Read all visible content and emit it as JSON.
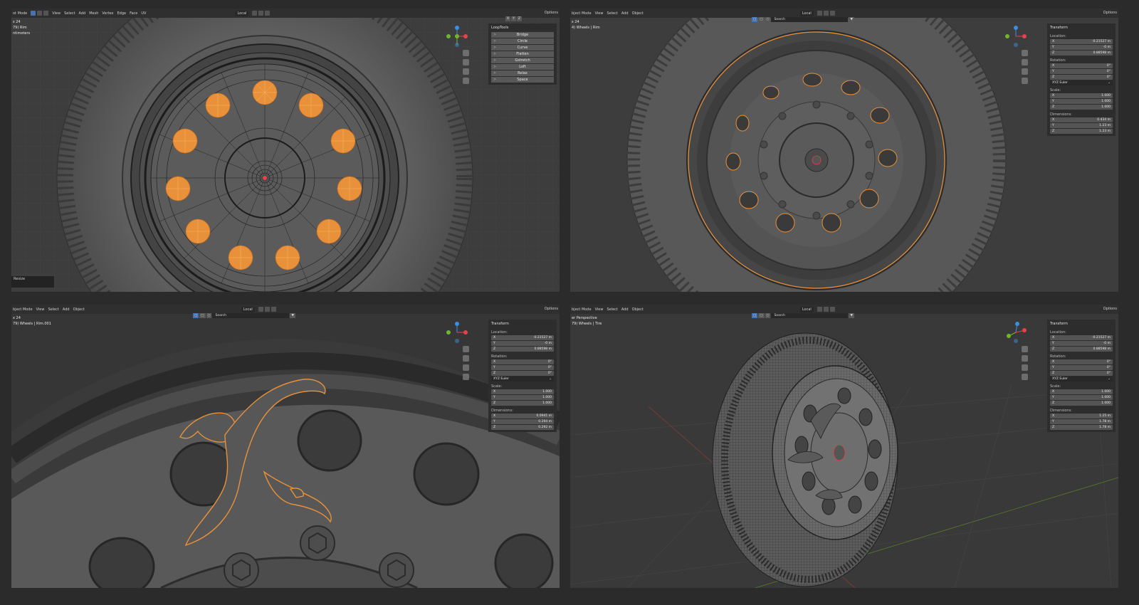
{
  "viewports": {
    "tl": {
      "header": {
        "menus": [
          "ot Mode",
          "View",
          "Select",
          "Add",
          "Mesh",
          "Vertex",
          "Edge",
          "Face",
          "UV"
        ],
        "transform_orientation": "Local",
        "options": "Options"
      },
      "overlay": [
        "s 24",
        "79) Rim",
        "ntimeters"
      ],
      "panel": {
        "title": "LoopTools",
        "tools": [
          "Bridge",
          "Circle",
          "Curve",
          "Flatten",
          "Gstretch",
          "Loft",
          "Relax",
          "Space"
        ]
      },
      "axes_buttons": [
        "X",
        "Y",
        "Z"
      ],
      "status": "Resize"
    },
    "tr": {
      "header": {
        "menus": [
          "bject Mode",
          "View",
          "Select",
          "Add",
          "Object"
        ],
        "transform_orientation": "Local",
        "search_placeholder": "Search",
        "options": "Options"
      },
      "overlay": [
        "s 24",
        "4) Wheels | Rim"
      ],
      "panel": {
        "title": "Transform",
        "location_label": "Location:",
        "location": [
          {
            "axis": "X",
            "value": "-0.21527 m"
          },
          {
            "axis": "Y",
            "value": "-0 m"
          },
          {
            "axis": "Z",
            "value": "0.88598 m"
          }
        ],
        "rotation_label": "Rotation:",
        "rotation": [
          {
            "axis": "X",
            "value": "0°"
          },
          {
            "axis": "Y",
            "value": "0°"
          },
          {
            "axis": "Z",
            "value": "0°"
          }
        ],
        "rotation_mode": "XYZ Euler",
        "scale_label": "Scale:",
        "scale": [
          {
            "axis": "X",
            "value": "1.000"
          },
          {
            "axis": "Y",
            "value": "1.000"
          },
          {
            "axis": "Z",
            "value": "1.000"
          }
        ],
        "dimensions_label": "Dimensions:",
        "dimensions": [
          {
            "axis": "X",
            "value": "0.434 m"
          },
          {
            "axis": "Y",
            "value": "1.23 m"
          },
          {
            "axis": "Z",
            "value": "1.23 m"
          }
        ]
      }
    },
    "bl": {
      "header": {
        "menus": [
          "bject Mode",
          "View",
          "Select",
          "Add",
          "Object"
        ],
        "transform_orientation": "Local",
        "search_placeholder": "Search",
        "options": "Options"
      },
      "overlay": [
        "x 24",
        "79) Wheels | Rim.001"
      ],
      "panel": {
        "title": "Transform",
        "location_label": "Location:",
        "location": [
          {
            "axis": "X",
            "value": "-0.21527 m"
          },
          {
            "axis": "Y",
            "value": "-0 m"
          },
          {
            "axis": "Z",
            "value": "0.88598 m"
          }
        ],
        "rotation_label": "Rotation:",
        "rotation": [
          {
            "axis": "X",
            "value": "0°"
          },
          {
            "axis": "Y",
            "value": "0°"
          },
          {
            "axis": "Z",
            "value": "0°"
          }
        ],
        "rotation_mode": "XYZ Euler",
        "scale_label": "Scale:",
        "scale": [
          {
            "axis": "X",
            "value": "1.000"
          },
          {
            "axis": "Y",
            "value": "1.000"
          },
          {
            "axis": "Z",
            "value": "1.000"
          }
        ],
        "dimensions_label": "Dimensions:",
        "dimensions": [
          {
            "axis": "X",
            "value": "0.0941 m"
          },
          {
            "axis": "Y",
            "value": "0.294 m"
          },
          {
            "axis": "Z",
            "value": "0.292 m"
          }
        ]
      }
    },
    "br": {
      "header": {
        "menus": [
          "bject Mode",
          "View",
          "Select",
          "Add",
          "Object"
        ],
        "transform_orientation": "Local",
        "search_placeholder": "Search",
        "options": "Options"
      },
      "overlay": [
        "er Perspective",
        "79) Wheels | Tire"
      ],
      "panel": {
        "title": "Transform",
        "location_label": "Location:",
        "location": [
          {
            "axis": "X",
            "value": "-0.21527 m"
          },
          {
            "axis": "Y",
            "value": "-0 m"
          },
          {
            "axis": "Z",
            "value": "0.88598 m"
          }
        ],
        "rotation_label": "Rotation:",
        "rotation": [
          {
            "axis": "X",
            "value": "0°"
          },
          {
            "axis": "Y",
            "value": "0°"
          },
          {
            "axis": "Z",
            "value": "0°"
          }
        ],
        "rotation_mode": "XYZ Euler",
        "scale_label": "Scale:",
        "scale": [
          {
            "axis": "X",
            "value": "1.000"
          },
          {
            "axis": "Y",
            "value": "1.000"
          },
          {
            "axis": "Z",
            "value": "1.000"
          }
        ],
        "dimensions_label": "Dimensions:",
        "dimensions": [
          {
            "axis": "X",
            "value": "1.25 m"
          },
          {
            "axis": "Y",
            "value": "1.78 m"
          },
          {
            "axis": "Z",
            "value": "1.78 m"
          }
        ]
      }
    }
  },
  "icons": [
    "menu-icon",
    "gizmo-axis-icon",
    "zoom-icon",
    "hand-icon",
    "camera-icon",
    "grid-icon",
    "filter-icon"
  ],
  "colors": {
    "selection": "#e8913a",
    "axis_x": "#e8414a",
    "axis_y": "#6fb62b",
    "axis_z": "#3b8fe0",
    "active_button": "#4772b3"
  }
}
